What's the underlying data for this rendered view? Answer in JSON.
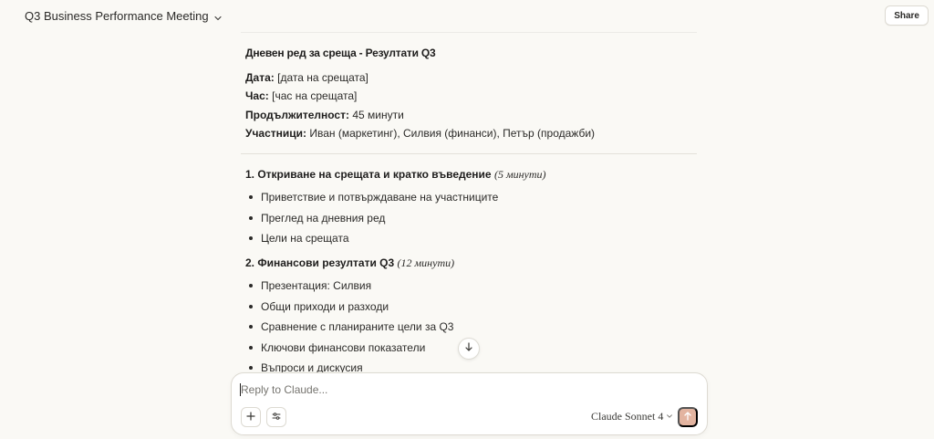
{
  "header": {
    "title": "Q3 Business Performance Meeting",
    "share_label": "Share"
  },
  "document": {
    "heading": "Дневен ред за среща - Резултати Q3",
    "meta": [
      {
        "label": "Дата:",
        "value": "[дата на срещата]"
      },
      {
        "label": "Час:",
        "value": "[час на срещата]"
      },
      {
        "label": "Продължителност:",
        "value": "45 минути"
      },
      {
        "label": "Участници:",
        "value": "Иван (маркетинг), Силвия (финанси), Петър (продажби)"
      }
    ],
    "sections": [
      {
        "title": "1. Откриване на срещата и кратко въведение",
        "duration": "(5 минути)",
        "items": [
          "Приветствие и потвърждаване на участниците",
          "Преглед на дневния ред",
          "Цели на срещата"
        ]
      },
      {
        "title": "2. Финансови резултати Q3",
        "duration": "(12 минути)",
        "items": [
          "Презентация: Силвия",
          "Общи приходи и разходи",
          "Сравнение с планираните цели за Q3",
          "Ключови финансови показатели",
          "Въпроси и дискусия"
        ]
      }
    ]
  },
  "composer": {
    "placeholder": "Reply to Claude...",
    "model_label": "Claude Sonnet 4"
  },
  "icons": {
    "title_chevron": "chevron-down-icon",
    "scroll": "arrow-down-icon",
    "add": "plus-icon",
    "tools": "sliders-icon",
    "model_chevron": "chevron-down-icon",
    "send": "arrow-up-icon"
  },
  "colors": {
    "background": "#faf9f5",
    "send_button": "#e3b4a0"
  }
}
